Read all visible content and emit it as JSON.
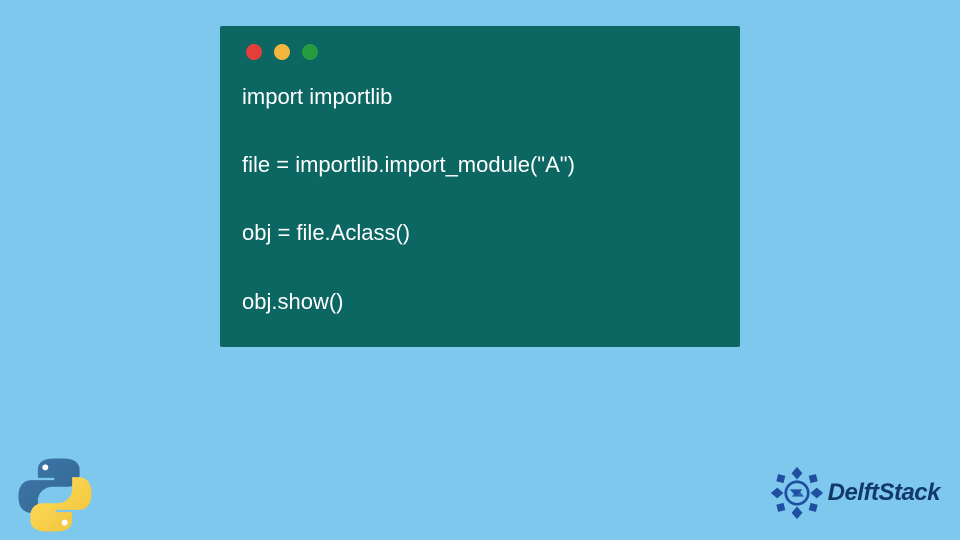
{
  "code": {
    "lines": [
      "import importlib",
      "",
      "file = importlib.import_module(\"A\")",
      "",
      "obj = file.Aclass()",
      "",
      "obj.show()"
    ]
  },
  "branding": {
    "delft_text": "DelftStack"
  },
  "icons": {
    "python": "python-logo",
    "delft": "delftstack-logo"
  }
}
